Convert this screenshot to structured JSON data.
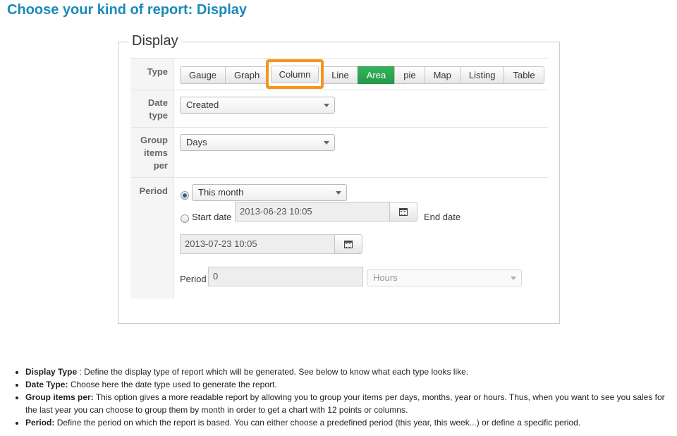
{
  "page_title": "Choose your kind of report: Display",
  "fieldset": {
    "legend": "Display",
    "type": {
      "label": "Type",
      "buttons": [
        "Gauge",
        "Graph",
        "Column",
        "Line",
        "Area",
        "pie",
        "Map",
        "Listing",
        "Table"
      ],
      "active": "Area",
      "highlighted": "Column",
      "highlight_color": "#f7941d",
      "active_color": "#2ea44f"
    },
    "date_type": {
      "label_line1": "Date",
      "label_line2": "type",
      "value": "Created"
    },
    "group_items": {
      "label_line1": "Group",
      "label_line2": "items",
      "label_line3": "per",
      "value": "Days"
    },
    "period": {
      "label": "Period",
      "predefined_value": "This month",
      "start_label": "Start date",
      "start_value": "2013-06-23 10:05",
      "end_label": "End date",
      "end_value": "2013-07-23 10:05",
      "period_label": "Period",
      "period_value": "0",
      "period_unit": "Hours"
    }
  },
  "notes": [
    {
      "term": "Display Type",
      "sep": " : ",
      "text": "Define the display type of report which will be generated. See below to know what each type looks like."
    },
    {
      "term": "Date Type:",
      "sep": " ",
      "text": "Choose here the date type used to generate the report."
    },
    {
      "term": "Group items per:",
      "sep": " ",
      "text": "This option gives a more readable report by allowing you to group your items per days, months, year or hours. Thus, when you want to see you sales for the last year you can choose to group them by month in order to get a chart with 12 points or columns."
    },
    {
      "term": "Period:",
      "sep": " ",
      "text": "Define the period on which the report is based. You can either choose a predefined period (this year, this week...) or define a specific period."
    }
  ],
  "icons": {
    "calendar": "calendar-icon",
    "dropdown": "chevron-down-icon"
  }
}
